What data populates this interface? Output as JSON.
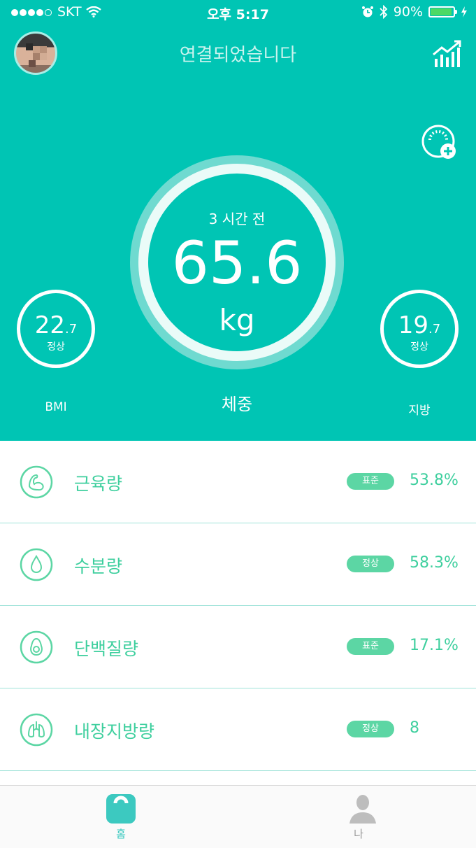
{
  "status_bar": {
    "carrier": "SKT",
    "time": "오후 5:17",
    "battery": "90%",
    "battery_level": 0.9
  },
  "header": {
    "title": "연결되었습니다",
    "avatar": "user-avatar",
    "chart_icon": "chart-trend-icon",
    "add_scale_icon": "scale-add-icon"
  },
  "main": {
    "time_ago": "3 시간 전",
    "weight_value": "65.6",
    "weight_unit": "kg",
    "weight_label": "체중"
  },
  "bmi": {
    "int": "22",
    "dec": ".7",
    "status": "정상",
    "label": "BMI"
  },
  "fat": {
    "int": "19",
    "dec": ".7",
    "status": "정상",
    "label": "지방"
  },
  "metrics": [
    {
      "name": "근육량",
      "badge": "표준",
      "value": "53.8%",
      "icon": "muscle-icon"
    },
    {
      "name": "수분량",
      "badge": "정상",
      "value": "58.3%",
      "icon": "water-drop-icon"
    },
    {
      "name": "단백질량",
      "badge": "표준",
      "value": "17.1%",
      "icon": "avocado-icon"
    },
    {
      "name": "내장지방량",
      "badge": "정상",
      "value": "8",
      "icon": "lungs-icon"
    }
  ],
  "tabs": [
    {
      "label": "홈",
      "icon": "scale-home-icon",
      "active": true
    },
    {
      "label": "나",
      "icon": "person-icon",
      "active": false
    }
  ],
  "colors": {
    "brand": "#00c5b4",
    "accent_green": "#3ecf9e",
    "badge": "#5cd6a4",
    "tab_active": "#3cc9c0",
    "tab_inactive": "#9a9a9a"
  }
}
